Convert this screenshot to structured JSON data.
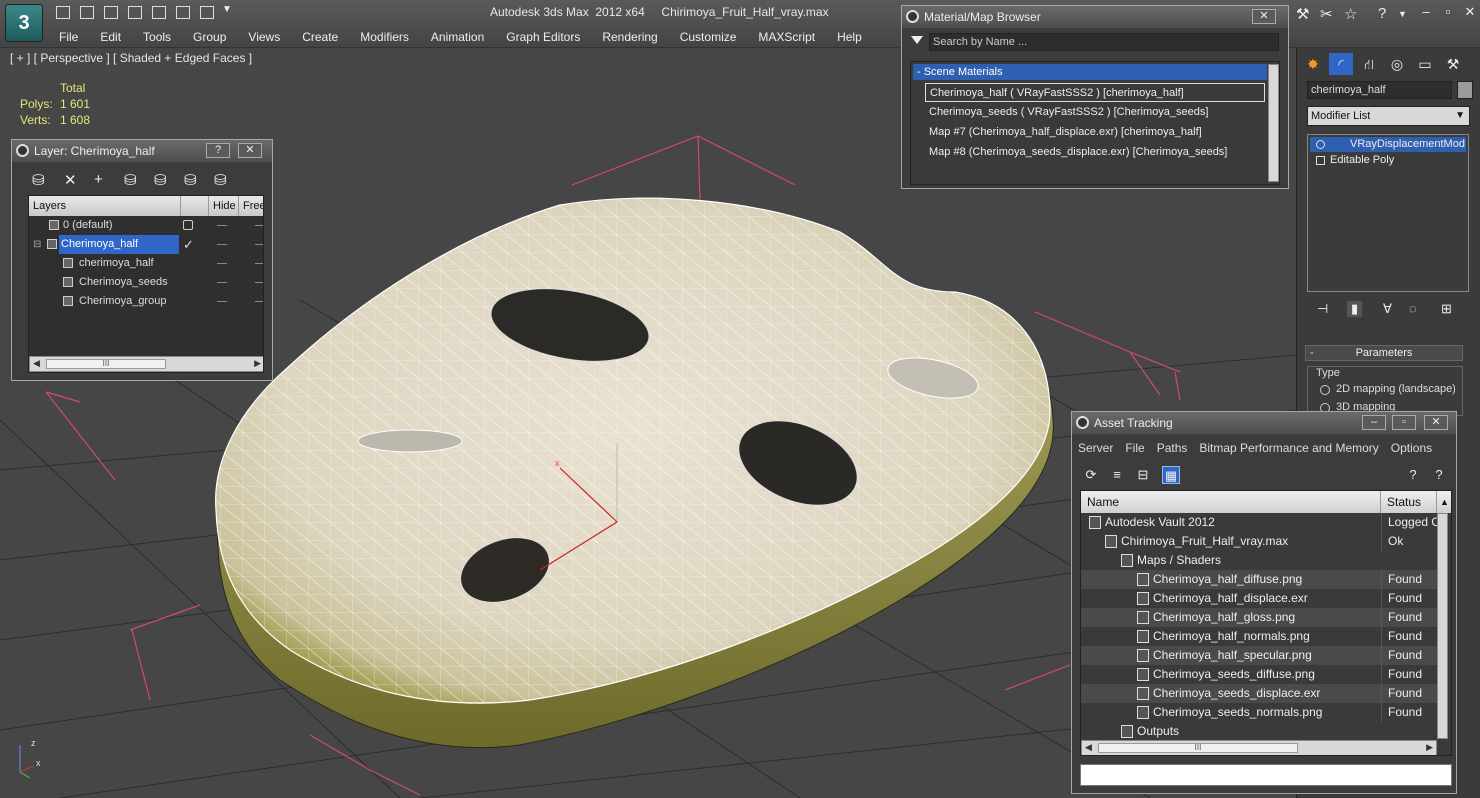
{
  "app": {
    "title": "Autodesk 3ds Max  2012 x64     Chirimoya_Fruit_Half_vray.max",
    "logo": "3"
  },
  "menu": [
    "File",
    "Edit",
    "Tools",
    "Group",
    "Views",
    "Create",
    "Modifiers",
    "Animation",
    "Graph Editors",
    "Rendering",
    "Customize",
    "MAXScript",
    "Help"
  ],
  "viewport": {
    "label": "[ + ] [ Perspective ] [ Shaded + Edged Faces ]",
    "stats": {
      "total_label": "Total",
      "polys_label": "Polys:",
      "polys": "1 601",
      "verts_label": "Verts:",
      "verts": "1 608"
    },
    "gizmo": {
      "x": "x",
      "z": "z"
    },
    "axis_tripod": {
      "x": "x",
      "z": "z"
    }
  },
  "layer_panel": {
    "title": "Layer: Cherimoya_half",
    "help": "?",
    "close": "✕",
    "columns": [
      "Layers",
      "Hide",
      "Free"
    ],
    "rows": [
      {
        "name": "0 (default)"
      },
      {
        "name": "Cherimoya_half",
        "selected": true
      },
      {
        "name": "cherimoya_half"
      },
      {
        "name": "Cherimoya_seeds"
      },
      {
        "name": "Cherimoya_group"
      }
    ],
    "scroll_mark": "III"
  },
  "material_browser": {
    "title": "Material/Map Browser",
    "close": "✕",
    "search_placeholder": "Search by Name ...",
    "group": "- Scene Materials",
    "items": [
      "Cherimoya_half  ( VRayFastSSS2 )  [cherimoya_half]",
      "Cherimoya_seeds  ( VRayFastSSS2 )  [Cherimoya_seeds]",
      "Map #7 (Cherimoya_half_displace.exr)  [cherimoya_half]",
      "Map #8 (Cherimoya_seeds_displace.exr)  [Cherimoya_seeds]"
    ]
  },
  "command_panel": {
    "object_name": "cherimoya_half",
    "modifier_list": "Modifier List",
    "stack": [
      "VRayDisplacementMod",
      "Editable Poly"
    ],
    "params_title": "Parameters",
    "params_minus": "-",
    "type_label": "Type",
    "type_options": [
      "2D mapping (landscape)",
      "3D mapping"
    ],
    "colors": {
      "selection": "#2f5fb0"
    }
  },
  "asset_tracking": {
    "title": "Asset Tracking",
    "menu": [
      "Server",
      "File",
      "Paths",
      "Bitmap Performance and Memory",
      "Options"
    ],
    "columns": [
      "Name",
      "Status"
    ],
    "rows": [
      {
        "name": "Autodesk Vault 2012",
        "status": "Logged Out",
        "indent": 0
      },
      {
        "name": "Chirimoya_Fruit_Half_vray.max",
        "status": "Ok",
        "indent": 1
      },
      {
        "name": "Maps / Shaders",
        "status": "",
        "indent": 2
      },
      {
        "name": "Cherimoya_half_diffuse.png",
        "status": "Found",
        "indent": 3
      },
      {
        "name": "Cherimoya_half_displace.exr",
        "status": "Found",
        "indent": 3
      },
      {
        "name": "Cherimoya_half_gloss.png",
        "status": "Found",
        "indent": 3
      },
      {
        "name": "Cherimoya_half_normals.png",
        "status": "Found",
        "indent": 3
      },
      {
        "name": "Cherimoya_half_specular.png",
        "status": "Found",
        "indent": 3
      },
      {
        "name": "Cherimoya_seeds_diffuse.png",
        "status": "Found",
        "indent": 3
      },
      {
        "name": "Cherimoya_seeds_displace.exr",
        "status": "Found",
        "indent": 3
      },
      {
        "name": "Cherimoya_seeds_normals.png",
        "status": "Found",
        "indent": 3
      },
      {
        "name": "Outputs",
        "status": "",
        "indent": 2
      }
    ],
    "scroll_mark": "III"
  }
}
